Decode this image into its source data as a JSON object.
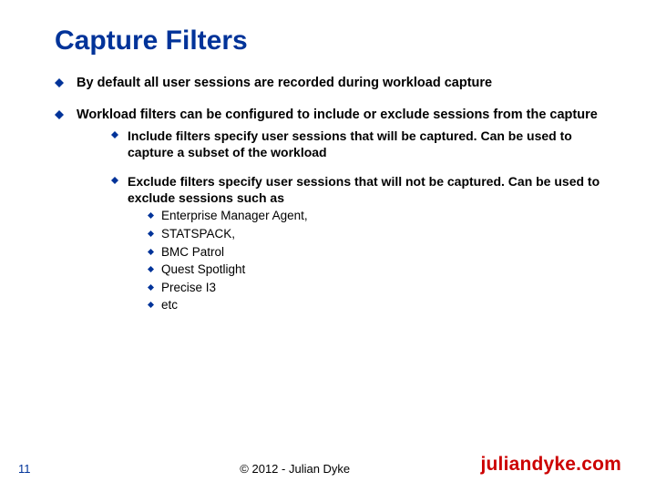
{
  "title": "Capture Filters",
  "bullets": {
    "b0": "By default all user sessions are recorded during workload capture",
    "b1": "Workload filters can be configured to include or exclude sessions from the capture",
    "b1_0": "Include filters specify user sessions that will be captured. Can be used to capture a subset of the workload",
    "b1_1": "Exclude filters specify user sessions that will not be captured.  Can be used to exclude sessions such as",
    "b1_1_0": "Enterprise Manager Agent,",
    "b1_1_1": "STATSPACK,",
    "b1_1_2": "BMC Patrol",
    "b1_1_3": "Quest Spotlight",
    "b1_1_4": "Precise I3",
    "b1_1_5": "etc"
  },
  "footer": {
    "page": "11",
    "copyright": "© 2012 - Julian Dyke",
    "site": "juliandyke.com"
  }
}
